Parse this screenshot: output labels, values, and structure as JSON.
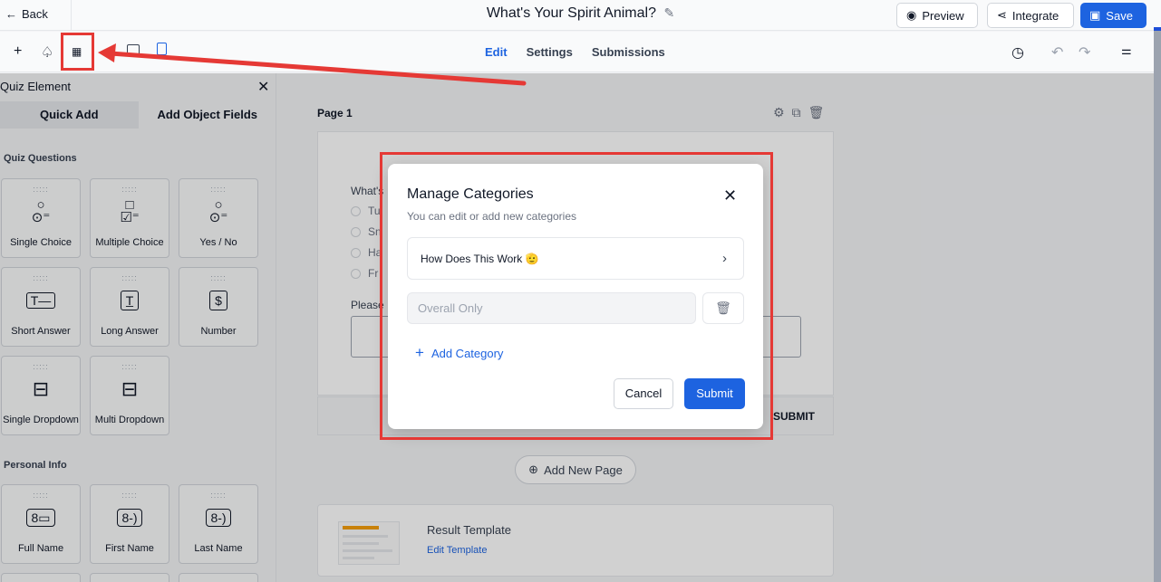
{
  "topbar": {
    "back_label": "Back",
    "title": "What's Your Spirit Animal?",
    "preview_label": "Preview",
    "integrate_label": "Integrate",
    "save_label": "Save"
  },
  "toolbar": {
    "tabs": [
      "Edit",
      "Settings",
      "Submissions"
    ],
    "active_tab": "Edit"
  },
  "panel": {
    "title": "Quiz Element",
    "tabs": [
      "Quick Add",
      "Add Object Fields"
    ],
    "sections": [
      {
        "label": "Quiz Questions",
        "tiles": [
          {
            "label": "Single Choice",
            "icon": "single-choice-icon"
          },
          {
            "label": "Multiple Choice",
            "icon": "multiple-choice-icon"
          },
          {
            "label": "Yes / No",
            "icon": "yes-no-icon"
          },
          {
            "label": "Short Answer",
            "icon": "short-answer-icon"
          },
          {
            "label": "Long Answer",
            "icon": "long-answer-icon"
          },
          {
            "label": "Number",
            "icon": "number-icon"
          },
          {
            "label": "Single Dropdown",
            "icon": "dropdown-icon"
          },
          {
            "label": "Multi Dropdown",
            "icon": "dropdown-icon"
          }
        ]
      },
      {
        "label": "Personal Info",
        "tiles": [
          {
            "label": "Full Name",
            "icon": "name-card-icon"
          },
          {
            "label": "First Name",
            "icon": "name-card-icon"
          },
          {
            "label": "Last Name",
            "icon": "name-card-icon"
          }
        ]
      }
    ]
  },
  "canvas": {
    "page_label": "Page 1",
    "question_partial": "What's",
    "options_partial": [
      "Tu",
      "Sn",
      "Ha",
      "Fr"
    ],
    "please_partial": "Please",
    "submit_label": "SUBMIT",
    "add_page_label": "Add New Page",
    "result_title": "Result Template",
    "result_link": "Edit Template"
  },
  "modal": {
    "title": "Manage Categories",
    "subtitle": "You can edit or add new categories",
    "category_label": "How Does This Work 🫡",
    "input_placeholder": "Overall Only",
    "add_category_label": "Add Category",
    "cancel_label": "Cancel",
    "submit_label": "Submit"
  },
  "colors": {
    "accent": "#1d63e0",
    "annotation": "#e53935"
  }
}
